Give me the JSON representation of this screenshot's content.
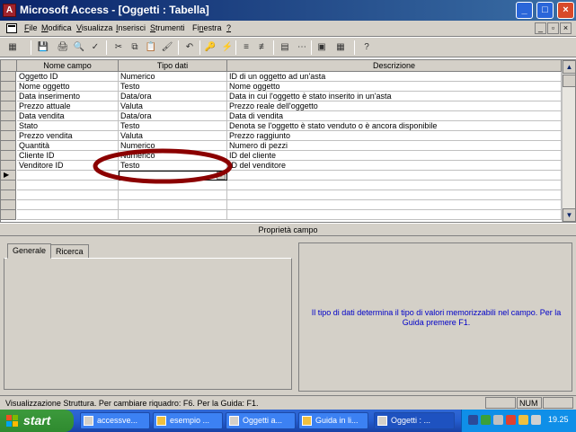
{
  "window": {
    "title": "Microsoft Access - [Oggetti : Tabella]",
    "app_icon": "A",
    "controls": {
      "minimize": "_",
      "maximize": "□",
      "close": "×"
    }
  },
  "menu": {
    "items": [
      {
        "underline": "F",
        "rest": "ile"
      },
      {
        "underline": "M",
        "rest": "odifica"
      },
      {
        "underline": "V",
        "rest": "isualizza"
      },
      {
        "underline": "I",
        "rest": "nserisci"
      },
      {
        "underline": "S",
        "rest": "trumenti"
      },
      {
        "prefix": "Fi",
        "underline": "n",
        "rest": "estra"
      },
      {
        "underline": "?",
        "rest": ""
      }
    ],
    "doc_controls": {
      "minimize": "_",
      "restore": "▫",
      "close": "×"
    }
  },
  "toolbar": {
    "icons": [
      "view-icon",
      "save-icon",
      "print-icon",
      "print-preview-icon",
      "spelling-icon",
      "cut-icon",
      "copy-icon",
      "paste-icon",
      "format-painter-icon",
      "undo-icon",
      "primary-key-icon",
      "indexes-icon",
      "insert-rows-icon",
      "delete-rows-icon",
      "properties-icon",
      "build-icon",
      "database-window-icon",
      "new-object-icon",
      "help-icon"
    ],
    "glyphs": [
      "▦",
      "💾",
      "🖨",
      "🔍",
      "✓",
      "✂",
      "⧉",
      "📋",
      "🖌",
      "↶",
      "🔑",
      "⚡",
      "≡",
      "≢",
      "▤",
      "⋯",
      "▣",
      "▦",
      "?"
    ]
  },
  "grid": {
    "headers": [
      "Nome campo",
      "Tipo dati",
      "Descrizione"
    ],
    "rows": [
      {
        "name": "Oggetto ID",
        "type": "Numerico",
        "desc": "ID di un oggetto ad un'asta"
      },
      {
        "name": "Nome oggetto",
        "type": "Testo",
        "desc": "Nome oggetto"
      },
      {
        "name": "Data inserimento",
        "type": "Data/ora",
        "desc": "Data in cui l'oggetto è stato inserito in un'asta"
      },
      {
        "name": "Prezzo attuale",
        "type": "Valuta",
        "desc": "Prezzo reale dell'oggetto"
      },
      {
        "name": "Data vendita",
        "type": "Data/ora",
        "desc": "Data di vendita"
      },
      {
        "name": "Stato",
        "type": "Testo",
        "desc": "Denota se l'oggetto è stato venduto o è ancora disponibile"
      },
      {
        "name": "Prezzo vendita",
        "type": "Valuta",
        "desc": "Prezzo raggiunto"
      },
      {
        "name": "Quantità",
        "type": "Numerico",
        "desc": "Numero di pezzi"
      },
      {
        "name": "Cliente ID",
        "type": "Numerico",
        "desc": "ID del cliente"
      },
      {
        "name": "Venditore ID",
        "type": "Testo",
        "desc": "ID del venditore"
      }
    ],
    "new_row_indicator": "▶",
    "dropdown_arrow": "▼",
    "scroll_up": "▲",
    "scroll_down": "▼"
  },
  "properties": {
    "title": "Proprietà campo",
    "tabs": [
      "Generale",
      "Ricerca"
    ],
    "help_text": "Il tipo di dati determina il tipo di valori memorizzabili nel campo. Per la Guida premere F1."
  },
  "statusbar": {
    "text": "Visualizzazione Struttura. Per cambiare riquadro: F6. Per la Guida: F1.",
    "num": "NUM"
  },
  "taskbar": {
    "start": "start",
    "tasks": [
      "accessve...",
      "esempio ...",
      "Oggetti a...",
      "Guida in li...",
      "Oggetti : ..."
    ],
    "clock": "19.25"
  },
  "colors": {
    "highlight_ellipse": "#8b0000",
    "help_text": "#0000c8",
    "title_bar": "#0a246a"
  }
}
